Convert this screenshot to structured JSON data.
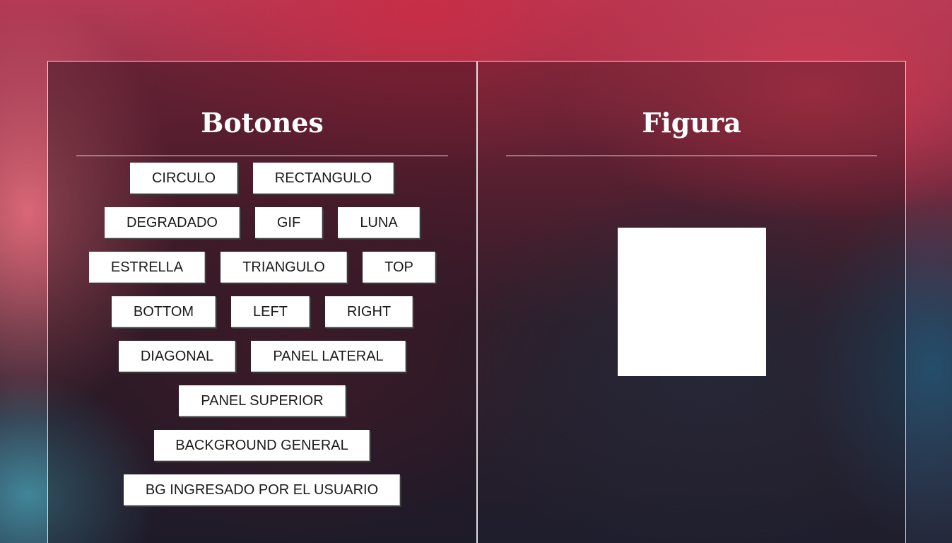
{
  "left_panel": {
    "title": "Botones",
    "buttons": [
      "CIRCULO",
      "RECTANGULO",
      "DEGRADADO",
      "GIF",
      "LUNA",
      "ESTRELLA",
      "TRIANGULO",
      "TOP",
      "BOTTOM",
      "LEFT",
      "RIGHT",
      "DIAGONAL",
      "PANEL LATERAL",
      "PANEL SUPERIOR",
      "BACKGROUND GENERAL",
      "BG INGRESADO POR EL USUARIO"
    ]
  },
  "right_panel": {
    "title": "Figura",
    "shape": {
      "type": "rectangle",
      "color": "#ffffff"
    }
  },
  "colors": {
    "panel_border": "#ffffff",
    "button_bg": "#ffffff",
    "button_text": "#1a1a1a"
  }
}
